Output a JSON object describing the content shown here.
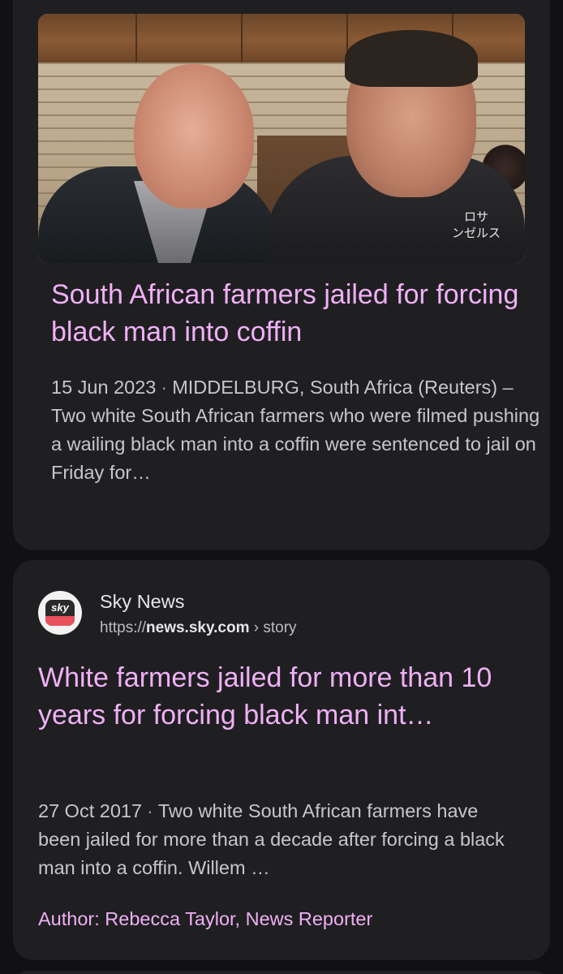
{
  "result1": {
    "title": "South African farmers jailed for forcing black man into coffin",
    "date": "15 Jun 2023",
    "snippet": "MIDDELBURG, South Africa (Reuters) – Two white South African farmers who were filmed pushing a wailing black man into a coffin were sentenced to jail on Friday for…",
    "image_shirt_text_line1": "ロサ",
    "image_shirt_text_line2": "ンゼルス"
  },
  "result2": {
    "site_name": "Sky News",
    "url_prefix": "https://",
    "url_domain": "news.sky.com",
    "url_path": " › story",
    "favicon_text": "sky",
    "title": "White farmers jailed for more than 10 years for forcing black man int…",
    "date": "27 Oct 2017",
    "snippet": "Two white South African farmers have been jailed for more than a decade after forcing a black man into a coffin. Willem …",
    "author": "Author: Rebecca Taylor, News Reporter"
  },
  "separator": "·",
  "colors": {
    "background": "#111113",
    "card": "#1f1f21",
    "title_link": "#f0b0f6",
    "body_text": "#c7c7c9"
  }
}
